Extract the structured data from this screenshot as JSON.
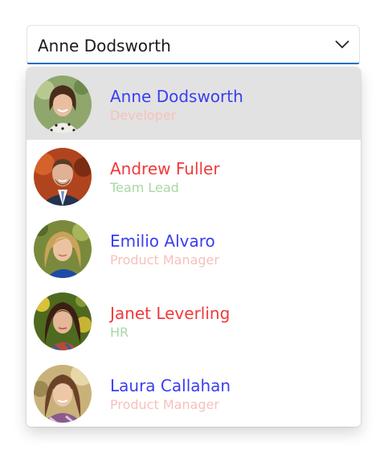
{
  "combobox": {
    "selected_text": "Anne Dodsworth",
    "dropdown_icon": "chevron-down-icon"
  },
  "colors": {
    "accent_underline": "#1f6fc6",
    "name_blue": "#3a3ef0",
    "name_red": "#f03a3a",
    "role_pink": "#f7c0bb",
    "role_green": "#a8d8a4",
    "selected_row_bg": "#e2e2e2"
  },
  "employees": [
    {
      "name": "Anne Dodsworth",
      "role": "Developer",
      "selected": true
    },
    {
      "name": "Andrew Fuller",
      "role": "Team Lead",
      "selected": false
    },
    {
      "name": "Emilio Alvaro",
      "role": "Product Manager",
      "selected": false
    },
    {
      "name": "Janet Leverling",
      "role": "HR",
      "selected": false
    },
    {
      "name": "Laura Callahan",
      "role": "Product Manager",
      "selected": false
    }
  ]
}
